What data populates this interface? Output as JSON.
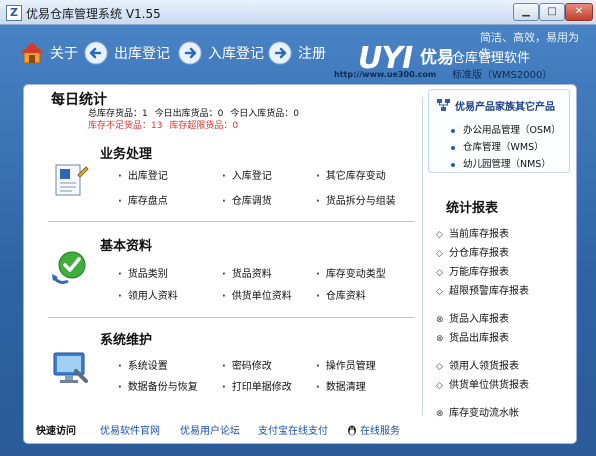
{
  "window": {
    "title": "优易仓库管理系统 V1.55",
    "icon_letter": "Z",
    "min_glyph": "▁",
    "max_glyph": "□",
    "close_glyph": "✕"
  },
  "toolbar": {
    "about_label": "关于",
    "outbound_label": "出库登记",
    "inbound_label": "入库登记",
    "register_label": "注册"
  },
  "brand": {
    "slogan": "简洁、高效，易用为先。",
    "logo": "UYI",
    "name": "优易",
    "software": "仓库管理软件",
    "url": "http://www.ue300.com",
    "edition": "标准版（WMS2000）"
  },
  "daily": {
    "title": "每日统计",
    "total_stock": "总库存货品：1",
    "today_out": "今日出库货品：0",
    "today_in": "今日入库货品：0",
    "low_stock": "库存不足货品：13",
    "over_stock": "库存超限货品：0"
  },
  "business": {
    "title": "业务处理",
    "items": [
      "出库登记",
      "入库登记",
      "其它库存变动",
      "库存盘点",
      "仓库调货",
      "货品拆分与组装"
    ]
  },
  "basic": {
    "title": "基本资料",
    "items": [
      "货品类别",
      "货品资料",
      "库存变动类型",
      "领用人资料",
      "供货单位资料",
      "仓库资料"
    ]
  },
  "system": {
    "title": "系统维护",
    "items": [
      "系统设置",
      "密码修改",
      "操作员管理",
      "数据备份与恢复",
      "打印单据修改",
      "数据清理"
    ]
  },
  "family": {
    "title": "优易产品家族其它产品",
    "items": [
      "办公用品管理（OSM）",
      "仓库管理（WMS）",
      "幼儿园管理（NMS）"
    ]
  },
  "reports": {
    "title": "统计报表",
    "group1": [
      "当前库存报表",
      "分仓库存报表",
      "万能库存报表",
      "超限预警库存报表"
    ],
    "group2": [
      "货品入库报表",
      "货品出库报表"
    ],
    "group3": [
      "领用人领货报表",
      "供货单位供货报表"
    ],
    "group4": [
      "库存变动流水帐"
    ]
  },
  "quick": {
    "label": "快速访问",
    "links": [
      "优易软件官网",
      "优易用户论坛",
      "支付宝在线支付",
      "在线服务"
    ]
  },
  "colors": {
    "banner": "#3d73b3",
    "warning": "#dd3333",
    "link": "#1a4fb0"
  }
}
